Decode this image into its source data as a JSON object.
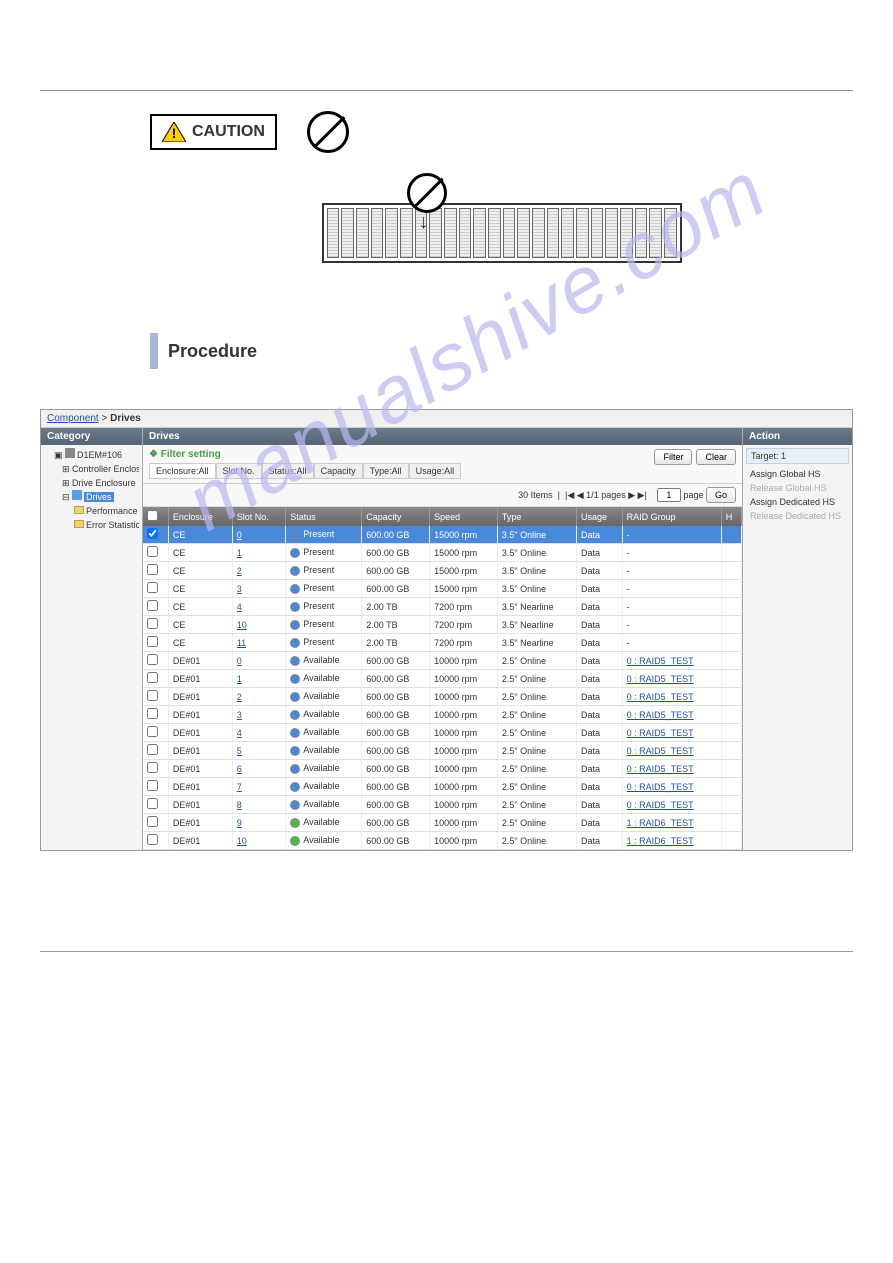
{
  "caution_label": "CAUTION",
  "procedure_heading": "Procedure",
  "watermark": "manualshive.com",
  "breadcrumb": {
    "root": "Component",
    "current": "Drives"
  },
  "sidebar": {
    "header": "Category",
    "nodes": {
      "device": "D1EM#106",
      "controller": "Controller Enclosure",
      "drive_enc": "Drive Enclosure",
      "drives": "Drives",
      "performance": "Performance",
      "error_stats": "Error Statistics"
    }
  },
  "filter": {
    "header": "Drives",
    "title": "Filter setting",
    "tabs": [
      "Enclosure:All",
      "Slot No.",
      "Status:All",
      "Capacity",
      "Type:All",
      "Usage:All"
    ],
    "filter_btn": "Filter",
    "clear_btn": "Clear"
  },
  "pager": {
    "items": "30 Items",
    "nav": "|◀  ◀   1/1 pages   ▶  ▶|",
    "page_val": "1",
    "page_unit": "page",
    "go": "Go"
  },
  "grid": {
    "headers": [
      "",
      "Enclosure",
      "Slot No.",
      "Status",
      "Capacity",
      "Speed",
      "Type",
      "Usage",
      "RAID Group",
      "H"
    ],
    "rows": [
      {
        "sel": true,
        "enc": "CE",
        "slot": "0",
        "status": "Present",
        "dot": "blue",
        "cap": "600.00 GB",
        "speed": "15000 rpm",
        "type": "3.5\" Online",
        "usage": "Data",
        "raid": "-"
      },
      {
        "sel": false,
        "enc": "CE",
        "slot": "1",
        "status": "Present",
        "dot": "blue",
        "cap": "600.00 GB",
        "speed": "15000 rpm",
        "type": "3.5\" Online",
        "usage": "Data",
        "raid": "-"
      },
      {
        "sel": false,
        "enc": "CE",
        "slot": "2",
        "status": "Present",
        "dot": "blue",
        "cap": "600.00 GB",
        "speed": "15000 rpm",
        "type": "3.5\" Online",
        "usage": "Data",
        "raid": "-"
      },
      {
        "sel": false,
        "enc": "CE",
        "slot": "3",
        "status": "Present",
        "dot": "blue",
        "cap": "600.00 GB",
        "speed": "15000 rpm",
        "type": "3.5\" Online",
        "usage": "Data",
        "raid": "-"
      },
      {
        "sel": false,
        "enc": "CE",
        "slot": "4",
        "status": "Present",
        "dot": "blue",
        "cap": "2.00 TB",
        "speed": "7200 rpm",
        "type": "3.5\" Nearline",
        "usage": "Data",
        "raid": "-"
      },
      {
        "sel": false,
        "enc": "CE",
        "slot": "10",
        "status": "Present",
        "dot": "blue",
        "cap": "2.00 TB",
        "speed": "7200 rpm",
        "type": "3.5\" Nearline",
        "usage": "Data",
        "raid": "-"
      },
      {
        "sel": false,
        "enc": "CE",
        "slot": "11",
        "status": "Present",
        "dot": "blue",
        "cap": "2.00 TB",
        "speed": "7200 rpm",
        "type": "3.5\" Nearline",
        "usage": "Data",
        "raid": "-"
      },
      {
        "sel": false,
        "enc": "DE#01",
        "slot": "0",
        "status": "Available",
        "dot": "blue",
        "cap": "600.00 GB",
        "speed": "10000 rpm",
        "type": "2.5\" Online",
        "usage": "Data",
        "raid": "0 : RAID5_TEST"
      },
      {
        "sel": false,
        "enc": "DE#01",
        "slot": "1",
        "status": "Available",
        "dot": "blue",
        "cap": "600.00 GB",
        "speed": "10000 rpm",
        "type": "2.5\" Online",
        "usage": "Data",
        "raid": "0 : RAID5_TEST"
      },
      {
        "sel": false,
        "enc": "DE#01",
        "slot": "2",
        "status": "Available",
        "dot": "blue",
        "cap": "600.00 GB",
        "speed": "10000 rpm",
        "type": "2.5\" Online",
        "usage": "Data",
        "raid": "0 : RAID5_TEST"
      },
      {
        "sel": false,
        "enc": "DE#01",
        "slot": "3",
        "status": "Available",
        "dot": "blue",
        "cap": "600.00 GB",
        "speed": "10000 rpm",
        "type": "2.5\" Online",
        "usage": "Data",
        "raid": "0 : RAID5_TEST"
      },
      {
        "sel": false,
        "enc": "DE#01",
        "slot": "4",
        "status": "Available",
        "dot": "blue",
        "cap": "600.00 GB",
        "speed": "10000 rpm",
        "type": "2.5\" Online",
        "usage": "Data",
        "raid": "0 : RAID5_TEST"
      },
      {
        "sel": false,
        "enc": "DE#01",
        "slot": "5",
        "status": "Available",
        "dot": "blue",
        "cap": "600.00 GB",
        "speed": "10000 rpm",
        "type": "2.5\" Online",
        "usage": "Data",
        "raid": "0 : RAID5_TEST"
      },
      {
        "sel": false,
        "enc": "DE#01",
        "slot": "6",
        "status": "Available",
        "dot": "blue",
        "cap": "600.00 GB",
        "speed": "10000 rpm",
        "type": "2.5\" Online",
        "usage": "Data",
        "raid": "0 : RAID5_TEST"
      },
      {
        "sel": false,
        "enc": "DE#01",
        "slot": "7",
        "status": "Available",
        "dot": "blue",
        "cap": "600.00 GB",
        "speed": "10000 rpm",
        "type": "2.5\" Online",
        "usage": "Data",
        "raid": "0 : RAID5_TEST"
      },
      {
        "sel": false,
        "enc": "DE#01",
        "slot": "8",
        "status": "Available",
        "dot": "blue",
        "cap": "600.00 GB",
        "speed": "10000 rpm",
        "type": "2.5\" Online",
        "usage": "Data",
        "raid": "0 : RAID5_TEST"
      },
      {
        "sel": false,
        "enc": "DE#01",
        "slot": "9",
        "status": "Available",
        "dot": "green",
        "cap": "600.00 GB",
        "speed": "10000 rpm",
        "type": "2.5\" Online",
        "usage": "Data",
        "raid": "1 : RAID6_TEST"
      },
      {
        "sel": false,
        "enc": "DE#01",
        "slot": "10",
        "status": "Available",
        "dot": "green",
        "cap": "600.00 GB",
        "speed": "10000 rpm",
        "type": "2.5\" Online",
        "usage": "Data",
        "raid": "1 : RAID6_TEST"
      }
    ]
  },
  "action": {
    "header": "Action",
    "target": "Target: 1",
    "links": [
      {
        "text": "Assign Global HS",
        "enabled": true
      },
      {
        "text": "Release Global HS",
        "enabled": false
      },
      {
        "text": "Assign Dedicated HS",
        "enabled": true
      },
      {
        "text": "Release Dedicated HS",
        "enabled": false
      }
    ]
  }
}
